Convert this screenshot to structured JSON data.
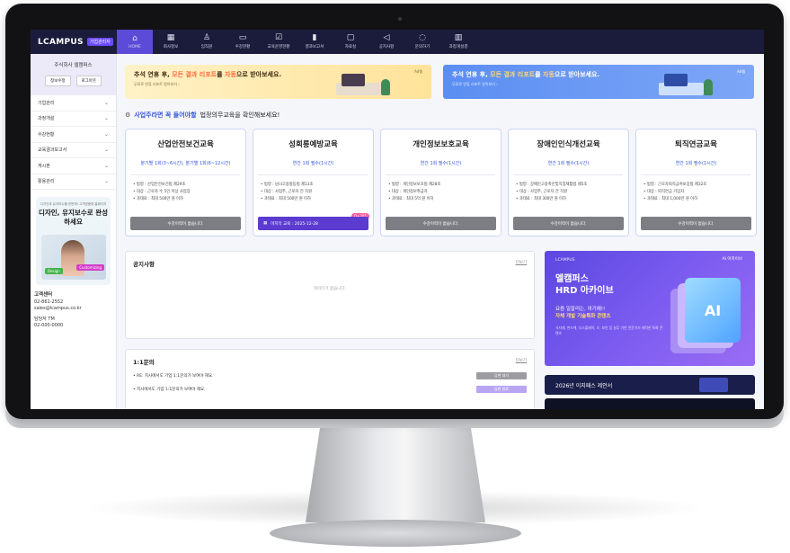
{
  "topnav": {
    "logo": "LCAMPUS",
    "logo_badge": "기업관리자",
    "items": [
      {
        "label": "HOME",
        "icon": "home-icon",
        "glyph": "⌂"
      },
      {
        "label": "회사정보",
        "icon": "building-icon",
        "glyph": "▦"
      },
      {
        "label": "임직원",
        "icon": "user-icon",
        "glyph": "♙"
      },
      {
        "label": "수강현황",
        "icon": "monitor-icon",
        "glyph": "▭"
      },
      {
        "label": "교육운영현황",
        "icon": "checklist-icon",
        "glyph": "☑"
      },
      {
        "label": "결과보고서",
        "icon": "bar-chart-icon",
        "glyph": "▮"
      },
      {
        "label": "자료실",
        "icon": "folder-icon",
        "glyph": "▢"
      },
      {
        "label": "공지사항",
        "icon": "megaphone-icon",
        "glyph": "◁"
      },
      {
        "label": "문의하기",
        "icon": "chat-icon",
        "glyph": "◌"
      },
      {
        "label": "과정개설결",
        "icon": "calendar-icon",
        "glyph": "▥"
      }
    ]
  },
  "sidebar": {
    "company_name": "주식회사 엘캠퍼스",
    "btn_info": "정보수정",
    "btn_logout": "로그아웃",
    "menu": [
      "기업관리",
      "과정개설",
      "수강현황",
      "교육결과보고서",
      "게시판",
      "활용관리"
    ],
    "promo_sub": "디자인과 유지보수를 한번에! 고객맞춤형 홈페이지",
    "promo_title": "디자인, 유지보수로 완성하세요",
    "promo_tag1": "Design",
    "promo_tag2": "Customizing",
    "support_title": "고객센터",
    "support_phone": "02-861-2552",
    "support_email": "sales@lcampus.co.kr",
    "rep_title": "담당자 TM",
    "rep_phone": "02-000-0000"
  },
  "banners": [
    {
      "prefix": "추석 연휴 후, ",
      "highlight": "모든 결과 리포트",
      "mid": "를 ",
      "highlight2": "자동",
      "suffix": "으로 받아보세요.",
      "sub": "무료로 연휴 리포트 받아보기 ›",
      "ad": "Ad텔"
    },
    {
      "prefix": "추석 연휴 후, ",
      "highlight": "모든 결과 리포트",
      "mid": "를 ",
      "highlight2": "자동",
      "suffix": "으로 받아보세요.",
      "sub": "무료로 연휴 리포트 받아보기 ›",
      "ad": "Ad텔"
    }
  ],
  "notice_line": {
    "prefix": "사업주라면 꼭 들어야할",
    "suffix": "법정의무교육을 확인해보세요!"
  },
  "cards": [
    {
      "title": "산업안전보건교육",
      "period": "분기별 1회(3~6시간), 분기별 1회(6~12시간)",
      "lines": [
        "• 법령 : 산업안전보건법 제29조",
        "• 대상 : 근로자 수 5인 이상 사업장",
        "• 과태료 : 최대 500만 원 이하"
      ],
      "button": "수강이력이 없습니다."
    },
    {
      "title": "성희롱예방교육",
      "period": "연간 1회 필수(1시간)",
      "lines": [
        "• 법령 : 남녀고용평등법 제13조",
        "• 대상 : 사업주, 근로자 전 직원",
        "• 과태료 : 최대 500만 원 이하"
      ],
      "button": "마지막 교육 : 2025-12-28",
      "badge": "D+205"
    },
    {
      "title": "개인정보보호교육",
      "period": "연간 1회 필수(1시간)",
      "lines": [
        "• 법령 : 개인정보보호법 제28조",
        "• 대상 : 개인정보취급자",
        "• 과태료 : 최대 5억 원 이하"
      ],
      "button": "수강이력이 없습니다."
    },
    {
      "title": "장애인인식개선교육",
      "period": "연간 1회 필수(1시간)",
      "lines": [
        "• 법령 : 장애인고용촉진및직업재활법 제5조",
        "• 대상 : 사업주, 근로자 전 직원",
        "• 과태료 : 최대 300만 원 이하"
      ],
      "button": "수강이력이 없습니다."
    },
    {
      "title": "퇴직연금교육",
      "period": "연간 1회 필수(1시간)",
      "lines": [
        "• 법령 : 근로자퇴직급여보장법 제32조",
        "• 대상 : 퇴직연금 가입자",
        "• 과태료 : 최대 1,000만 원 이하"
      ],
      "button": "수강이력이 없습니다."
    }
  ],
  "notice_panel": {
    "title": "공지사항",
    "more": "더보기",
    "empty": "데이터가 없습니다."
  },
  "qna_panel": {
    "title": "1:1문의",
    "more": "더보기",
    "rows": [
      {
        "text": "RE: 지사에서도 기업 1:1문의가 보여야 해요.",
        "status": "답변 대기"
      },
      {
        "text": "지사에서도 기업 1:1문의가 보여야 해요.",
        "status": "답변 완료"
      }
    ]
  },
  "hrd": {
    "brand": "LCAMPUS",
    "ai_label": "AI 아카이브",
    "title_line1": "엘캠퍼스",
    "title_line2": "HRD 아카이브",
    "mid_line1": "요즘 일잘러는, 여기에!!",
    "mid_line2": "자체 개발 기술특화 콘텐츠",
    "small": "식자재, 펀드케, 디스플레이, IT, 보안 등 실무 기반 전문가가 제작한 특화 콘텐츠",
    "ai_box": "AI"
  },
  "resource_bar": "2026년 이지패스 제안서"
}
